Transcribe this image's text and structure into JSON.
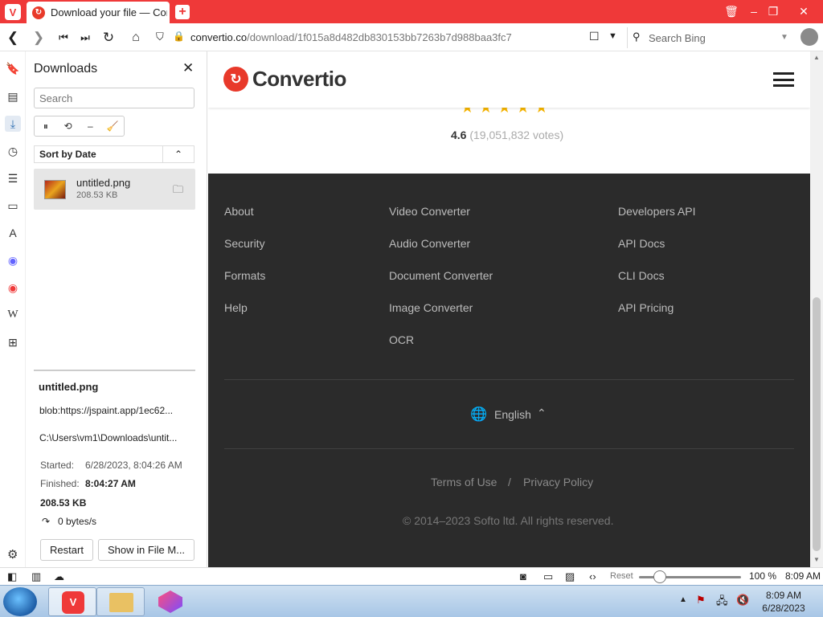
{
  "browser": {
    "tab_title": "Download your file — Convertio",
    "url_host": "convertio.co",
    "url_path": "/download/1f015a8d482db830153bb7263b7d988baa3fc7",
    "search_placeholder": "Search Bing",
    "colors": {
      "chrome": "#ef3939",
      "accent": "#e8392a"
    }
  },
  "downloads": {
    "title": "Downloads",
    "search_placeholder": "Search",
    "sort_label": "Sort by Date",
    "item": {
      "name": "untitled.png",
      "size": "208.53 KB"
    },
    "detail": {
      "name": "untitled.png",
      "source": "blob:https://jspaint.app/1ec62...",
      "path": "C:\\Users\\vm1\\Downloads\\untit...",
      "started_label": "Started:",
      "started_value": "6/28/2023, 8:04:26 AM",
      "finished_label": "Finished:",
      "finished_value": "8:04:27 AM",
      "size": "208.53 KB",
      "speed": "0 bytes/s"
    },
    "restart_label": "Restart",
    "show_in_folder_label": "Show in File M..."
  },
  "site": {
    "logo_text": "Convertio",
    "stars": "★★★★★",
    "rating": "4.6",
    "votes": "(19,051,832 votes)",
    "footer_col1": [
      "About",
      "Security",
      "Formats",
      "Help"
    ],
    "footer_col2": [
      "Video Converter",
      "Audio Converter",
      "Document Converter",
      "Image Converter",
      "OCR"
    ],
    "footer_col3": [
      "Developers API",
      "API Docs",
      "CLI Docs",
      "API Pricing"
    ],
    "language": "English",
    "terms": "Terms of Use",
    "sep": "/",
    "privacy": "Privacy Policy",
    "copyright": "© 2014–2023 Softo ltd. All rights reserved."
  },
  "statusbar": {
    "reset_label": "Reset",
    "zoom": "100 %",
    "time": "8:09 AM"
  },
  "taskbar": {
    "time": "8:09 AM",
    "date": "6/28/2023"
  }
}
